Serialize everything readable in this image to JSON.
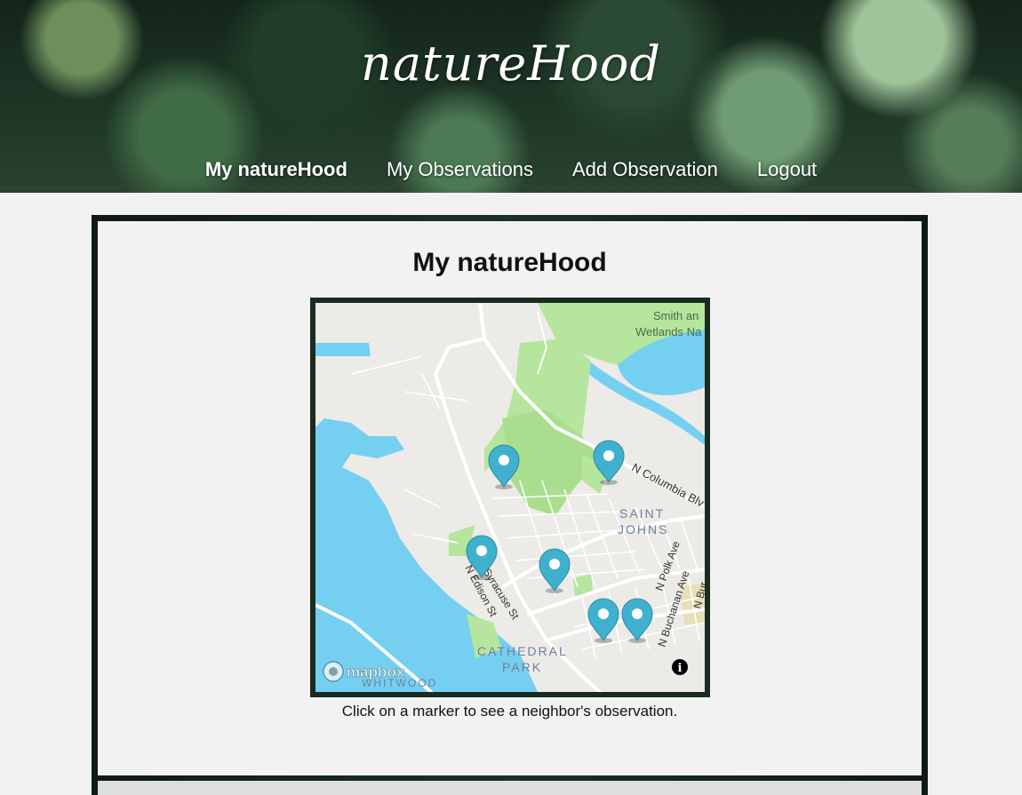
{
  "header": {
    "logo_text": "natureHood",
    "nav": [
      {
        "label": "My natureHood",
        "active": true
      },
      {
        "label": "My Observations",
        "active": false
      },
      {
        "label": "Add Observation",
        "active": false
      },
      {
        "label": "Logout",
        "active": false
      }
    ]
  },
  "main": {
    "title": "My natureHood",
    "caption": "Click on a marker to see a neighbor's observation."
  },
  "map": {
    "labels": {
      "wetlands_1": "Smith an",
      "wetlands_2": "Wetlands Na",
      "columbia": "N Columbia Blv",
      "saint": "SAINT",
      "johns": "JOHNS",
      "syracuse": "N Syracuse St",
      "edison": "N Edison St",
      "polk": "N Polk Ave",
      "buchanan": "N Buchanan Ave",
      "bur": "N Bur",
      "cathedral": "CATHEDRAL",
      "park": "PARK",
      "whitwood": "WHITWOOD",
      "attribution": "mapbox",
      "info": "i"
    },
    "colors": {
      "water": "#75cff0",
      "park": "#b6e59d",
      "land": "#ecebe7",
      "marker": "#3fb1ce"
    },
    "marker_count": 6
  }
}
